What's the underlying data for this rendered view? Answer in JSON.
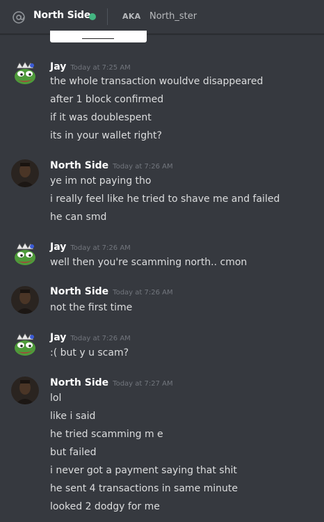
{
  "header": {
    "dm_name": "North Side",
    "aka_label": "AKA",
    "aka_name": "North_ster",
    "status_color": "#43b581",
    "icon": "at-icon"
  },
  "messages": [
    {
      "author": "Jay",
      "time": "Today at 7:25 AM",
      "avatar": "pepe-avatar",
      "lines": [
        "the whole transaction wouldve disappeared",
        "after 1 block confirmed",
        "if it was doublespent",
        "its in your wallet right?"
      ]
    },
    {
      "author": "North Side",
      "time": "Today at 7:26 AM",
      "avatar": "photo-avatar",
      "lines": [
        "ye im not paying tho",
        "i really feel like he tried to shave me and failed",
        "he can smd"
      ]
    },
    {
      "author": "Jay",
      "time": "Today at 7:26 AM",
      "avatar": "pepe-avatar",
      "lines": [
        "well then you're scamming north.. cmon"
      ]
    },
    {
      "author": "North Side",
      "time": "Today at 7:26 AM",
      "avatar": "photo-avatar",
      "lines": [
        "not the first time"
      ]
    },
    {
      "author": "Jay",
      "time": "Today at 7:26 AM",
      "avatar": "pepe-avatar",
      "lines": [
        ":( but y u scam?"
      ]
    },
    {
      "author": "North Side",
      "time": "Today at 7:27 AM",
      "avatar": "photo-avatar",
      "lines": [
        "lol",
        "like i said",
        "he tried scamming m e",
        "but failed",
        "i never got a payment saying that shit",
        "he sent 4 transactions in same minute",
        "looked 2 dodgy for me"
      ]
    }
  ]
}
